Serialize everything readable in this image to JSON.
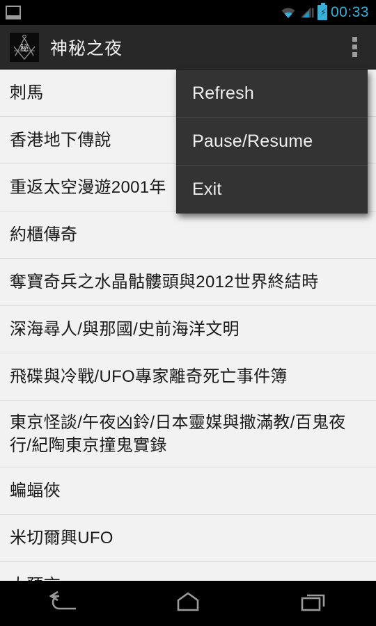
{
  "status_bar": {
    "notification_icon": "image-notification-icon",
    "wifi_icon": "wifi-icon",
    "signal_icon": "signal-bars-icon",
    "battery_icon": "battery-charging-icon",
    "time": "00:33",
    "accent_color": "#39b0d8",
    "background": "#000000"
  },
  "action_bar": {
    "app_icon": "masonic-square-compass-icon",
    "app_icon_glyph": "秘",
    "title": "神秘之夜",
    "overflow_icon": "overflow-menu-icon",
    "background": "#282828"
  },
  "overflow_menu": {
    "visible": true,
    "background": "#333333",
    "items": [
      {
        "label": "Refresh"
      },
      {
        "label": "Pause/Resume"
      },
      {
        "label": "Exit"
      }
    ]
  },
  "list": {
    "background": "#f2f2f2",
    "divider_color": "#dcdcdc",
    "items": [
      {
        "title": "刺馬",
        "lines": 1
      },
      {
        "title": "香港地下傳說",
        "lines": 1
      },
      {
        "title": "重返太空漫遊2001年",
        "lines": 1
      },
      {
        "title": "約櫃傳奇",
        "lines": 1
      },
      {
        "title": "奪寶奇兵之水晶骷髏頭與2012世界終結時",
        "lines": 1
      },
      {
        "title": "深海尋人/與那國/史前海洋文明",
        "lines": 1
      },
      {
        "title": "飛碟與冷戰/UFO專家離奇死亡事件簿",
        "lines": 1
      },
      {
        "title": "東京怪談/午夜凶鈴/日本靈媒與撒滿教/百鬼夜行/紀陶東京撞鬼實錄",
        "lines": 2
      },
      {
        "title": "蝙蝠俠",
        "lines": 1
      },
      {
        "title": "米切爾興UFO",
        "lines": 1
      },
      {
        "title": "大預言",
        "lines": 1
      }
    ]
  },
  "nav_bar": {
    "background": "#000000",
    "buttons": [
      {
        "name": "back-button",
        "icon": "back-arrow-icon"
      },
      {
        "name": "home-button",
        "icon": "home-icon"
      },
      {
        "name": "recents-button",
        "icon": "recents-icon"
      }
    ]
  }
}
